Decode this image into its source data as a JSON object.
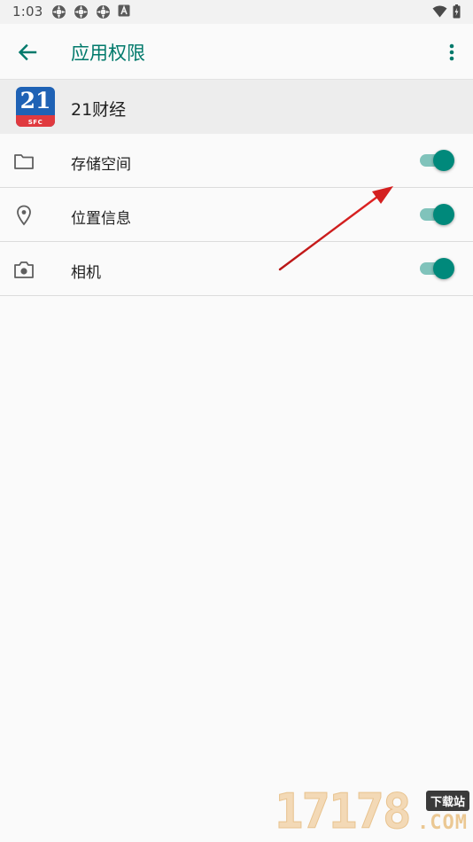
{
  "status_bar": {
    "time": "1:03",
    "left_icons": [
      "notification-icon",
      "notification-icon",
      "notification-icon",
      "text-a-icon"
    ],
    "right_icons": [
      "wifi-icon",
      "battery-icon"
    ]
  },
  "app_bar": {
    "title": "应用权限",
    "back_icon": "arrow-back-icon",
    "more_icon": "more-vert-icon"
  },
  "app": {
    "name": "21财经",
    "logo_number": "21",
    "logo_caption": "SFC"
  },
  "permissions": [
    {
      "label": "存储空间",
      "icon": "folder-icon",
      "enabled": true
    },
    {
      "label": "位置信息",
      "icon": "location-pin-icon",
      "enabled": true
    },
    {
      "label": "相机",
      "icon": "camera-icon",
      "enabled": true
    }
  ],
  "watermark": {
    "digits": "17178",
    "tag": "下载站",
    "suffix": ".COM"
  },
  "colors": {
    "accent": "#00796b",
    "toggle_thumb": "#00897b",
    "toggle_track": "#80c3bb",
    "annotation_arrow": "#d42020",
    "logo_blue": "#1f62b5",
    "logo_red": "#e03a3f"
  }
}
